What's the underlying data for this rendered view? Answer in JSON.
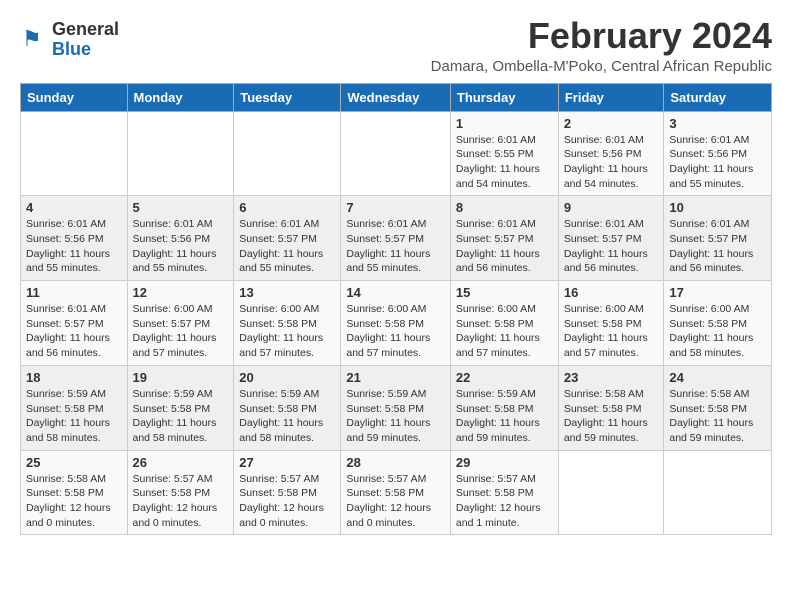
{
  "logo": {
    "general": "General",
    "blue": "Blue"
  },
  "title": "February 2024",
  "subtitle": "Damara, Ombella-M'Poko, Central African Republic",
  "days_of_week": [
    "Sunday",
    "Monday",
    "Tuesday",
    "Wednesday",
    "Thursday",
    "Friday",
    "Saturday"
  ],
  "weeks": [
    [
      {
        "day": "",
        "info": ""
      },
      {
        "day": "",
        "info": ""
      },
      {
        "day": "",
        "info": ""
      },
      {
        "day": "",
        "info": ""
      },
      {
        "day": "1",
        "info": "Sunrise: 6:01 AM\nSunset: 5:55 PM\nDaylight: 11 hours and 54 minutes."
      },
      {
        "day": "2",
        "info": "Sunrise: 6:01 AM\nSunset: 5:56 PM\nDaylight: 11 hours and 54 minutes."
      },
      {
        "day": "3",
        "info": "Sunrise: 6:01 AM\nSunset: 5:56 PM\nDaylight: 11 hours and 55 minutes."
      }
    ],
    [
      {
        "day": "4",
        "info": "Sunrise: 6:01 AM\nSunset: 5:56 PM\nDaylight: 11 hours and 55 minutes."
      },
      {
        "day": "5",
        "info": "Sunrise: 6:01 AM\nSunset: 5:56 PM\nDaylight: 11 hours and 55 minutes."
      },
      {
        "day": "6",
        "info": "Sunrise: 6:01 AM\nSunset: 5:57 PM\nDaylight: 11 hours and 55 minutes."
      },
      {
        "day": "7",
        "info": "Sunrise: 6:01 AM\nSunset: 5:57 PM\nDaylight: 11 hours and 55 minutes."
      },
      {
        "day": "8",
        "info": "Sunrise: 6:01 AM\nSunset: 5:57 PM\nDaylight: 11 hours and 56 minutes."
      },
      {
        "day": "9",
        "info": "Sunrise: 6:01 AM\nSunset: 5:57 PM\nDaylight: 11 hours and 56 minutes."
      },
      {
        "day": "10",
        "info": "Sunrise: 6:01 AM\nSunset: 5:57 PM\nDaylight: 11 hours and 56 minutes."
      }
    ],
    [
      {
        "day": "11",
        "info": "Sunrise: 6:01 AM\nSunset: 5:57 PM\nDaylight: 11 hours and 56 minutes."
      },
      {
        "day": "12",
        "info": "Sunrise: 6:00 AM\nSunset: 5:57 PM\nDaylight: 11 hours and 57 minutes."
      },
      {
        "day": "13",
        "info": "Sunrise: 6:00 AM\nSunset: 5:58 PM\nDaylight: 11 hours and 57 minutes."
      },
      {
        "day": "14",
        "info": "Sunrise: 6:00 AM\nSunset: 5:58 PM\nDaylight: 11 hours and 57 minutes."
      },
      {
        "day": "15",
        "info": "Sunrise: 6:00 AM\nSunset: 5:58 PM\nDaylight: 11 hours and 57 minutes."
      },
      {
        "day": "16",
        "info": "Sunrise: 6:00 AM\nSunset: 5:58 PM\nDaylight: 11 hours and 57 minutes."
      },
      {
        "day": "17",
        "info": "Sunrise: 6:00 AM\nSunset: 5:58 PM\nDaylight: 11 hours and 58 minutes."
      }
    ],
    [
      {
        "day": "18",
        "info": "Sunrise: 5:59 AM\nSunset: 5:58 PM\nDaylight: 11 hours and 58 minutes."
      },
      {
        "day": "19",
        "info": "Sunrise: 5:59 AM\nSunset: 5:58 PM\nDaylight: 11 hours and 58 minutes."
      },
      {
        "day": "20",
        "info": "Sunrise: 5:59 AM\nSunset: 5:58 PM\nDaylight: 11 hours and 58 minutes."
      },
      {
        "day": "21",
        "info": "Sunrise: 5:59 AM\nSunset: 5:58 PM\nDaylight: 11 hours and 59 minutes."
      },
      {
        "day": "22",
        "info": "Sunrise: 5:59 AM\nSunset: 5:58 PM\nDaylight: 11 hours and 59 minutes."
      },
      {
        "day": "23",
        "info": "Sunrise: 5:58 AM\nSunset: 5:58 PM\nDaylight: 11 hours and 59 minutes."
      },
      {
        "day": "24",
        "info": "Sunrise: 5:58 AM\nSunset: 5:58 PM\nDaylight: 11 hours and 59 minutes."
      }
    ],
    [
      {
        "day": "25",
        "info": "Sunrise: 5:58 AM\nSunset: 5:58 PM\nDaylight: 12 hours and 0 minutes."
      },
      {
        "day": "26",
        "info": "Sunrise: 5:57 AM\nSunset: 5:58 PM\nDaylight: 12 hours and 0 minutes."
      },
      {
        "day": "27",
        "info": "Sunrise: 5:57 AM\nSunset: 5:58 PM\nDaylight: 12 hours and 0 minutes."
      },
      {
        "day": "28",
        "info": "Sunrise: 5:57 AM\nSunset: 5:58 PM\nDaylight: 12 hours and 0 minutes."
      },
      {
        "day": "29",
        "info": "Sunrise: 5:57 AM\nSunset: 5:58 PM\nDaylight: 12 hours and 1 minute."
      },
      {
        "day": "",
        "info": ""
      },
      {
        "day": "",
        "info": ""
      }
    ]
  ]
}
